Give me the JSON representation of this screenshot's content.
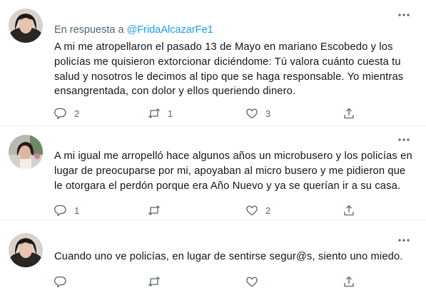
{
  "thread": [
    {
      "reply_prefix": "En respuesta a",
      "reply_handle": "@FridaAlcazarFe1",
      "text": "A mi me atropellaron el pasado 13 de Mayo en mariano Escobedo y los policías me quisieron extorcionar diciéndome: Tú valora cuánto cuesta tu salud y nosotros le decimos al tipo que se haga responsable. Yo mientras ensangrentada, con dolor y ellos queriendo dinero.",
      "replies": "2",
      "retweets": "1",
      "likes": "3"
    },
    {
      "text": "A mi igual me arropelló hace algunos años un microbusero y los policías en lugar de preocuparse por mi, apoyaban al micro busero y  me pidieron que le otorgara el perdón porque era Año Nuevo y ya se querían ir a su casa.",
      "replies": "1",
      "retweets": "",
      "likes": "2"
    },
    {
      "text": "Cuando uno ve policías, en lugar de sentirse segur@s, siento uno miedo.",
      "replies": "",
      "retweets": "",
      "likes": ""
    }
  ],
  "icons": [
    "more-icon",
    "reply-icon",
    "retweet-icon",
    "like-icon",
    "share-icon"
  ],
  "colors": {
    "text": "#0f1419",
    "secondary": "#536471",
    "link": "#1d9bf0",
    "divider": "#eff3f4"
  }
}
